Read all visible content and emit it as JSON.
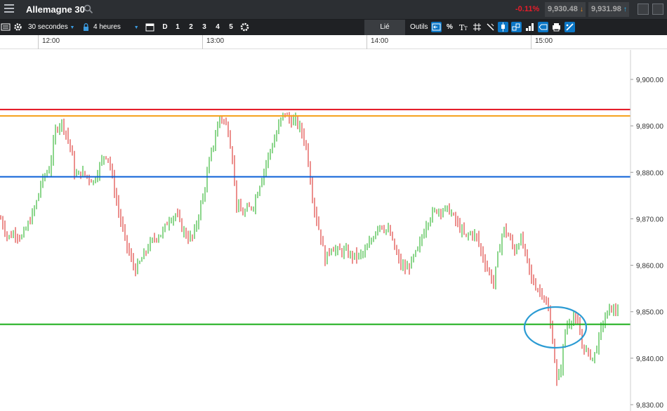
{
  "header": {
    "instrument": "Allemagne 30",
    "change": "-0.11%",
    "bid": "9,930.48",
    "ask": "9,931.98",
    "colors": {
      "negative": "#e81d2a",
      "bid_arrow": "#f7931e",
      "ask_arrow": "#2ab7f5"
    }
  },
  "toolbar": {
    "interval": "30 secondes",
    "range": "4 heures",
    "day_label": "D",
    "presets": [
      "1",
      "2",
      "3",
      "4",
      "5"
    ],
    "link_label": "Lié",
    "tools_label": "Outils",
    "percent_label": "%",
    "icons": [
      "list-icon",
      "gear-icon",
      "lock-icon",
      "calendar-icon",
      "settings-icon",
      "crosshair-back-icon",
      "text-size-icon",
      "grid-icon",
      "magic-wand-icon",
      "candlestick-icon",
      "chart-type-icon",
      "price-label-icon",
      "print-icon",
      "draw-icon"
    ]
  },
  "time_axis": [
    "12:00",
    "13:00",
    "14:00",
    "15:00"
  ],
  "chart_data": {
    "type": "candlestick",
    "instrument": "Allemagne 30",
    "interval": "30 secondes",
    "ylim": [
      9828,
      9910
    ],
    "y_ticks": [
      "9,830.00",
      "9,840.00",
      "9,850.00",
      "9,860.00",
      "9,870.00",
      "9,880.00",
      "9,890.00",
      "9,900.00"
    ],
    "x_ticks": [
      "12:00",
      "13:00",
      "14:00",
      "15:00"
    ],
    "horizontal_lines": [
      {
        "value": 9893.52,
        "label": "9,893.52",
        "color": "#e3101e"
      },
      {
        "value": 9892.14,
        "label": "9,892.14",
        "color": "#f5a21e"
      },
      {
        "value": 9879.05,
        "label": "9,879.05",
        "color": "#0a5fd6"
      },
      {
        "value": 9847.3,
        "label": "9,847.30",
        "color": "#1aad18"
      }
    ],
    "annotation": {
      "shape": "ellipse",
      "color": "#2b9bd3",
      "around": "9,847.30 near 15:00"
    },
    "colors": {
      "up": "#1aad18",
      "down": "#d9221c"
    },
    "close_path": [
      [
        0,
        9870
      ],
      [
        10,
        9866
      ],
      [
        20,
        9867
      ],
      [
        30,
        9866
      ],
      [
        40,
        9869
      ],
      [
        50,
        9873
      ],
      [
        58,
        9878
      ],
      [
        70,
        9881
      ],
      [
        78,
        9889
      ],
      [
        86,
        9891
      ],
      [
        92,
        9889
      ],
      [
        100,
        9885
      ],
      [
        106,
        9879
      ],
      [
        114,
        9880
      ],
      [
        124,
        9879
      ],
      [
        132,
        9878
      ],
      [
        140,
        9881
      ],
      [
        148,
        9884
      ],
      [
        154,
        9883
      ],
      [
        162,
        9876
      ],
      [
        170,
        9870
      ],
      [
        178,
        9865
      ],
      [
        186,
        9861
      ],
      [
        192,
        9859
      ],
      [
        200,
        9861
      ],
      [
        210,
        9864
      ],
      [
        220,
        9866
      ],
      [
        230,
        9867
      ],
      [
        240,
        9870
      ],
      [
        250,
        9871
      ],
      [
        258,
        9868
      ],
      [
        266,
        9866
      ],
      [
        274,
        9866
      ],
      [
        282,
        9871
      ],
      [
        290,
        9876
      ],
      [
        298,
        9883
      ],
      [
        306,
        9888
      ],
      [
        312,
        9892
      ],
      [
        318,
        9891
      ],
      [
        324,
        9889
      ],
      [
        330,
        9883
      ],
      [
        336,
        9873
      ],
      [
        344,
        9871
      ],
      [
        352,
        9872
      ],
      [
        360,
        9873
      ],
      [
        368,
        9877
      ],
      [
        374,
        9880
      ],
      [
        382,
        9884
      ],
      [
        390,
        9887
      ],
      [
        398,
        9891
      ],
      [
        404,
        9893
      ],
      [
        412,
        9891
      ],
      [
        420,
        9891
      ],
      [
        428,
        9889
      ],
      [
        436,
        9885
      ],
      [
        442,
        9877
      ],
      [
        448,
        9871
      ],
      [
        456,
        9866
      ],
      [
        462,
        9861
      ],
      [
        470,
        9864
      ],
      [
        480,
        9863
      ],
      [
        490,
        9863
      ],
      [
        500,
        9862
      ],
      [
        510,
        9862
      ],
      [
        520,
        9863
      ],
      [
        530,
        9866
      ],
      [
        538,
        9869
      ],
      [
        546,
        9868
      ],
      [
        554,
        9867
      ],
      [
        562,
        9863
      ],
      [
        570,
        9860
      ],
      [
        578,
        9859
      ],
      [
        586,
        9861
      ],
      [
        596,
        9864
      ],
      [
        606,
        9869
      ],
      [
        614,
        9871
      ],
      [
        622,
        9872
      ],
      [
        630,
        9872
      ],
      [
        638,
        9872
      ],
      [
        646,
        9870
      ],
      [
        654,
        9868
      ],
      [
        662,
        9866
      ],
      [
        670,
        9867
      ],
      [
        678,
        9866
      ],
      [
        686,
        9862
      ],
      [
        694,
        9859
      ],
      [
        702,
        9856
      ],
      [
        708,
        9862
      ],
      [
        716,
        9868
      ],
      [
        724,
        9866
      ],
      [
        732,
        9863
      ],
      [
        740,
        9866
      ],
      [
        748,
        9862
      ],
      [
        756,
        9857
      ],
      [
        764,
        9855
      ],
      [
        772,
        9854
      ],
      [
        780,
        9850
      ],
      [
        786,
        9844
      ],
      [
        792,
        9835
      ],
      [
        798,
        9838
      ],
      [
        804,
        9846
      ],
      [
        810,
        9848
      ],
      [
        816,
        9849
      ],
      [
        822,
        9847
      ],
      [
        828,
        9843
      ],
      [
        836,
        9841
      ],
      [
        844,
        9840
      ],
      [
        850,
        9843
      ],
      [
        856,
        9847
      ],
      [
        862,
        9849
      ],
      [
        868,
        9851
      ],
      [
        874,
        9850
      ],
      [
        880,
        9851
      ]
    ]
  }
}
